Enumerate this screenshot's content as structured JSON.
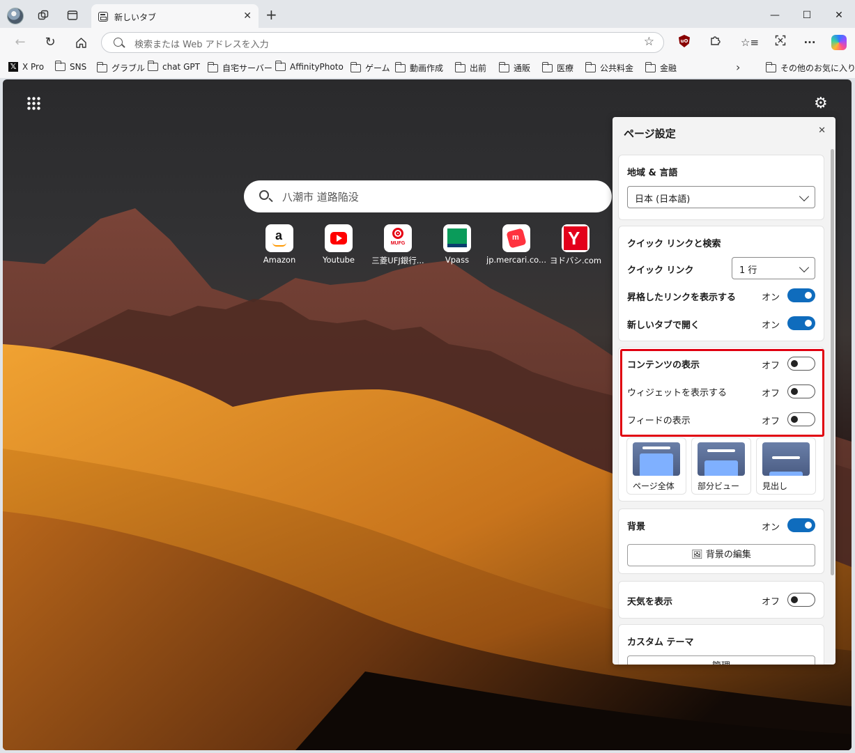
{
  "browser": {
    "tab_title": "新しいタブ",
    "tab_close": "✕",
    "new_tab": "+",
    "window_minimize": "—",
    "window_maximize": "☐",
    "window_close": "✕",
    "omnibox_placeholder": "検索または Web アドレスを入力",
    "star": "☆",
    "more_menu": "···"
  },
  "bookmarks": [
    {
      "label": "X Pro",
      "type": "x"
    },
    {
      "label": "SNS",
      "type": "folder"
    },
    {
      "label": "グラブル",
      "type": "folder"
    },
    {
      "label": "chat GPT",
      "type": "folder"
    },
    {
      "label": "自宅サーバー",
      "type": "folder"
    },
    {
      "label": "AffinityPhoto",
      "type": "folder"
    },
    {
      "label": "ゲーム",
      "type": "folder"
    },
    {
      "label": "動画作成",
      "type": "folder"
    },
    {
      "label": "出前",
      "type": "folder"
    },
    {
      "label": "通販",
      "type": "folder"
    },
    {
      "label": "医療",
      "type": "folder"
    },
    {
      "label": "公共料金",
      "type": "folder"
    },
    {
      "label": "金融",
      "type": "folder"
    }
  ],
  "bookmarks_more": "›",
  "bookmarks_other": "その他のお気に入り",
  "newtab": {
    "search_text": "八潮市 道路陥没",
    "quick_links": [
      {
        "label": "Amazon"
      },
      {
        "label": "Youtube"
      },
      {
        "label": "三菱UFJ銀行..."
      },
      {
        "label": "Vpass"
      },
      {
        "label": "jp.mercari.co..."
      },
      {
        "label": "ヨドバシ.com"
      }
    ],
    "mufg_logo_text": "MUFG"
  },
  "settings": {
    "title": "ページ設定",
    "close": "✕",
    "region": {
      "heading": "地域 & 言語",
      "value": "日本 (日本語)"
    },
    "quick": {
      "heading": "クイック リンクと検索",
      "quick_links_label": "クイック リンク",
      "quick_links_value": "1 行",
      "promoted_label": "昇格したリンクを表示する",
      "promoted_state": "オン",
      "new_tab_label": "新しいタブで開く",
      "new_tab_state": "オン"
    },
    "content": {
      "content_label": "コンテンツの表示",
      "content_state": "オフ",
      "widgets_label": "ウィジェットを表示する",
      "widgets_state": "オフ",
      "feed_label": "フィードの表示",
      "feed_state": "オフ"
    },
    "layouts": [
      {
        "label": "ページ全体"
      },
      {
        "label": "部分ビュー"
      },
      {
        "label": "見出し"
      }
    ],
    "background": {
      "label": "背景",
      "state": "オン",
      "edit_button": "背景の編集",
      "edit_icon": "🖼"
    },
    "weather": {
      "label": "天気を表示",
      "state": "オフ"
    },
    "theme": {
      "heading": "カスタム テーマ",
      "manage_button": "管理"
    }
  },
  "colors": {
    "accent": "#0f6cbd",
    "highlight": "#e00010"
  }
}
